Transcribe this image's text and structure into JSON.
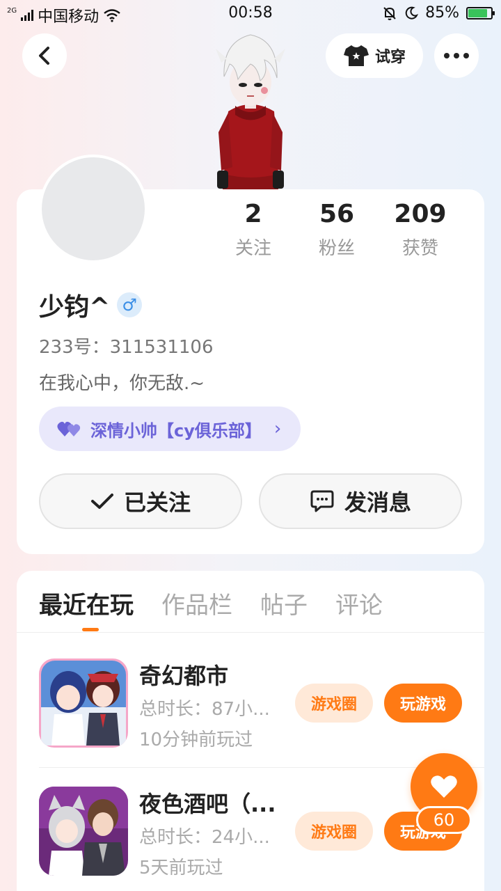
{
  "status_bar": {
    "network": "2G",
    "carrier": "中国移动",
    "time": "00:58",
    "battery": "85%",
    "battery_level": 0.85
  },
  "top_nav": {
    "tryon_label": "试穿"
  },
  "profile": {
    "stats": [
      {
        "value": "2",
        "label": "关注"
      },
      {
        "value": "56",
        "label": "粉丝"
      },
      {
        "value": "209",
        "label": "获赞"
      }
    ],
    "nickname": "少钧^",
    "gender_symbol": "♂",
    "uid": "233号：311531106",
    "bio": "在我心中，你无敌.~",
    "club": "深情小帅​【cy俱乐部】",
    "follow_label": "已关注",
    "message_label": "发消息"
  },
  "tabs": [
    {
      "label": "最近在玩",
      "active": true
    },
    {
      "label": "作品栏",
      "active": false
    },
    {
      "label": "帖子",
      "active": false
    },
    {
      "label": "评论",
      "active": false
    }
  ],
  "games": [
    {
      "title": "奇幻都市",
      "duration": "总时长：87小...",
      "last_played": "10分钟前玩过",
      "circle_label": "游戏圈",
      "play_label": "玩游戏"
    },
    {
      "title": "夜色酒吧（...",
      "duration": "总时长：24小...",
      "last_played": "5天前玩过",
      "circle_label": "游戏圈",
      "play_label": "玩游戏"
    }
  ],
  "like": {
    "count": "60"
  },
  "colors": {
    "accent": "#ff7a14",
    "club": "#6b63d8",
    "gender": "#3a8ee6"
  }
}
